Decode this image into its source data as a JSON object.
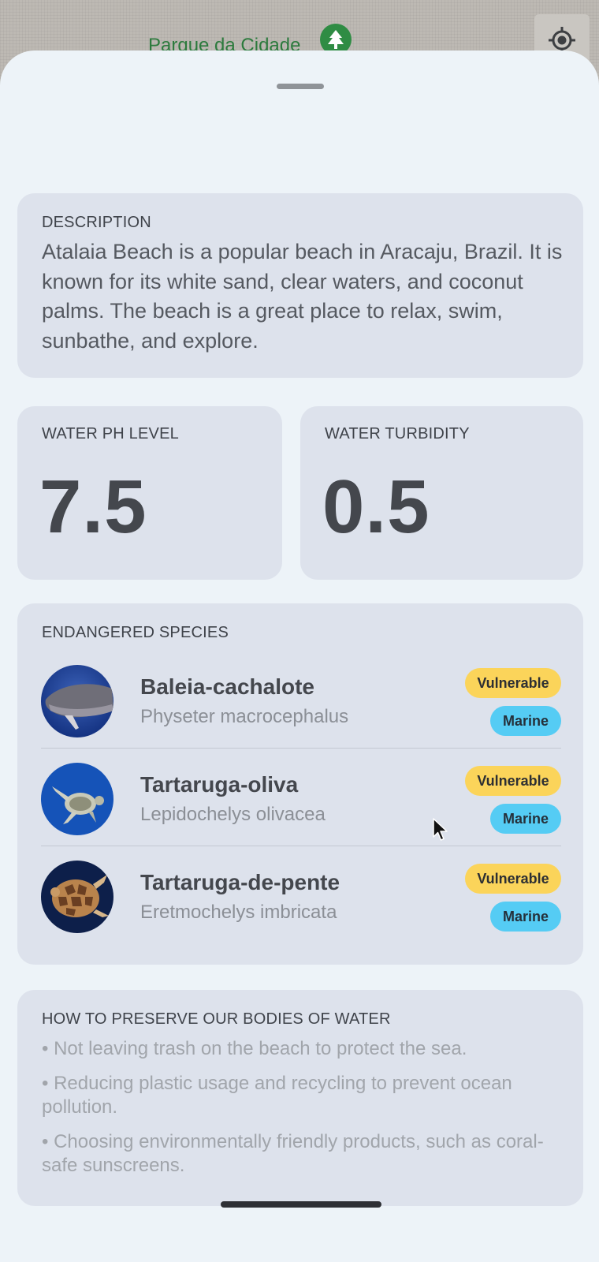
{
  "map": {
    "place_label": "Parque da Cidade",
    "place_icon": "tree-icon",
    "locate_icon": "crosshair-icon"
  },
  "description": {
    "title": "DESCRIPTION",
    "text": "Atalaia Beach is a popular beach in Aracaju, Brazil. It is known for its white sand, clear waters, and coconut palms. The beach is a great place to relax, swim, sunbathe, and explore."
  },
  "metrics": {
    "ph": {
      "title": "WATER PH LEVEL",
      "value": "7.5"
    },
    "turbidity": {
      "title": "WATER TURBIDITY",
      "value": "0.5"
    }
  },
  "species": {
    "title": "ENDANGERED SPECIES",
    "items": [
      {
        "name": "Baleia-cachalote",
        "scientific": "Physeter macrocephalus",
        "status": "Vulnerable",
        "habitat": "Marine",
        "image": "sperm-whale-photo"
      },
      {
        "name": "Tartaruga-oliva",
        "scientific": "Lepidochelys olivacea",
        "status": "Vulnerable",
        "habitat": "Marine",
        "image": "olive-ridley-turtle-photo"
      },
      {
        "name": "Tartaruga-de-pente",
        "scientific": "Eretmochelys imbricata",
        "status": "Vulnerable",
        "habitat": "Marine",
        "image": "hawksbill-turtle-photo"
      }
    ]
  },
  "preserve": {
    "title": "HOW TO PRESERVE OUR BODIES OF WATER",
    "tips": [
      "• Not leaving trash on the beach to protect the sea.",
      "• Reducing plastic usage and recycling to prevent ocean pollution.",
      "• Choosing environmentally friendly products, such as coral-safe sunscreens."
    ]
  },
  "colors": {
    "sheet_bg": "#edf3f8",
    "card_bg": "#dde2ec",
    "vulnerable_badge": "#fbd45a",
    "marine_badge": "#55ccf4",
    "park_green": "#2f8c44"
  }
}
